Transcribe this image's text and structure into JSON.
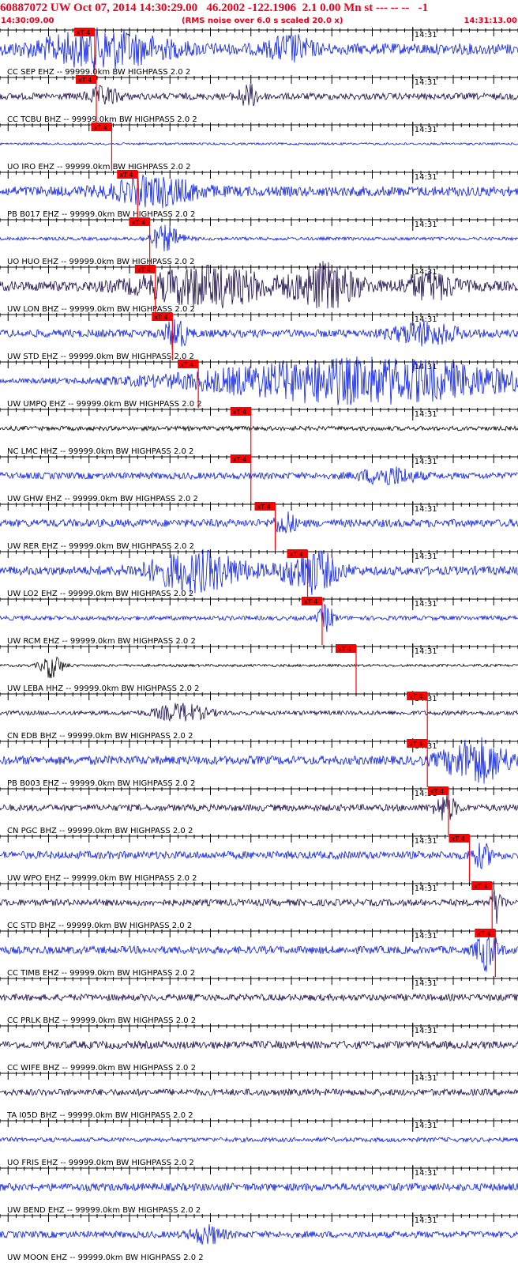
{
  "header": {
    "title": "60887072 UW Oct 07, 2014 14:30:29.00   46.2002 -122.1906  2.1 0.00 Mn st --- -- --   -1",
    "start_time": "14:30:09.00",
    "scale_note": "(RMS noise over 6.0 s scaled 20.0 x)",
    "end_time": "14:31:13.00"
  },
  "colors": {
    "header_red": "#e8001c",
    "pick_red": "#ff0000",
    "trace_blue": "#0a1ee6",
    "trace_dark": "#1a0a4a",
    "trace_black": "#000000",
    "grid": "#000000"
  },
  "chart_data": {
    "type": "seismogram",
    "time_start": "14:30:09.00",
    "time_end": "14:31:13.00",
    "minute_label": "14:31",
    "pick_label": "xT 4",
    "traces": [
      {
        "label": "CC SEP EHZ -- 99999.0km BW  HIGHPASS  2.0  2",
        "color": "blue",
        "pick": "14:30:20.7",
        "amp": 0.5,
        "bursts": [
          [
            0.2,
            0.12,
            0.8
          ],
          [
            0.56,
            0.04,
            0.55
          ]
        ]
      },
      {
        "label": "CC TCBU BHZ -- 99999.0km BW  HIGHPASS  2.0  2",
        "color": "dark",
        "pick": "14:30:20.9",
        "amp": 0.3,
        "bursts": [
          [
            0.2,
            0.03,
            0.4
          ],
          [
            0.48,
            0.02,
            0.5
          ]
        ]
      },
      {
        "label": "UO IRO EHZ -- 99999.0km BW  HIGHPASS  2.0  2",
        "color": "blue",
        "pick": "14:30:22.8",
        "amp": 0.1,
        "bursts": []
      },
      {
        "label": "PB B017 EHZ -- 99999.0km BW  HIGHPASS  2.0  2",
        "color": "blue",
        "pick": "14:30:26.0",
        "amp": 0.45,
        "bursts": [
          [
            0.3,
            0.08,
            0.6
          ]
        ]
      },
      {
        "label": "UO HUO EHZ -- 99999.0km BW  HIGHPASS  2.0  2",
        "color": "blue",
        "pick": "14:30:27.5",
        "amp": 0.15,
        "bursts": [
          [
            0.32,
            0.03,
            0.6
          ]
        ]
      },
      {
        "label": "UW LON BHZ -- 99999.0km BW  HIGHPASS  2.0  2",
        "color": "dark",
        "pick": "14:30:28.2",
        "amp": 0.45,
        "bursts": [
          [
            0.4,
            0.12,
            0.9
          ],
          [
            0.63,
            0.06,
            1.0
          ],
          [
            0.83,
            0.05,
            0.6
          ]
        ]
      },
      {
        "label": "UW STD EHZ -- 99999.0km BW  HIGHPASS  2.0  2",
        "color": "blue",
        "pick": "14:30:30.3",
        "amp": 0.35,
        "bursts": [
          [
            0.34,
            0.02,
            0.8
          ],
          [
            0.82,
            0.06,
            0.5
          ]
        ]
      },
      {
        "label": "UW UMPQ EHZ -- 99999.0km BW  HIGHPASS  2.0  2",
        "color": "blue",
        "pick": "14:30:33.5",
        "amp": 0.2,
        "bursts": [
          [
            0.7,
            0.32,
            1.1
          ]
        ]
      },
      {
        "label": "NC LMC HHZ -- 99999.0km BW  HIGHPASS  2.0  2",
        "color": "black",
        "pick": "14:30:40.0",
        "amp": 0.2,
        "bursts": []
      },
      {
        "label": "UW GHW EHZ -- 99999.0km BW  HIGHPASS  2.0  2",
        "color": "blue",
        "pick": "14:30:40.0",
        "amp": 0.3,
        "bursts": [
          [
            0.75,
            0.05,
            0.4
          ]
        ]
      },
      {
        "label": "UW RER EHZ -- 99999.0km BW  HIGHPASS  2.0  2",
        "color": "blue",
        "pick": "14:30:43.0",
        "amp": 0.35,
        "bursts": [
          [
            0.55,
            0.02,
            0.5
          ]
        ]
      },
      {
        "label": "UW LO2 EHZ -- 99999.0km BW  HIGHPASS  2.0  2",
        "color": "blue",
        "pick": "14:30:47.0",
        "amp": 0.4,
        "bursts": [
          [
            0.38,
            0.09,
            0.9
          ],
          [
            0.6,
            0.05,
            1.0
          ]
        ]
      },
      {
        "label": "UW RCM EHZ -- 99999.0km BW  HIGHPASS  2.0  2",
        "color": "blue",
        "pick": "14:30:48.8",
        "amp": 0.2,
        "bursts": [
          [
            0.63,
            0.015,
            0.6
          ]
        ]
      },
      {
        "label": "UW LEBA HHZ -- 99999.0km BW  HIGHPASS  2.0  2",
        "color": "black",
        "pick": "14:30:53.0",
        "amp": 0.12,
        "bursts": [
          [
            0.1,
            0.02,
            0.6
          ]
        ]
      },
      {
        "label": "CN EDB BHZ -- 99999.0km BW  HIGHPASS  2.0  2",
        "color": "dark",
        "pick": "14:31:01.8",
        "amp": 0.2,
        "bursts": [
          [
            0.35,
            0.05,
            0.4
          ]
        ]
      },
      {
        "label": "PB B003 EHZ -- 99999.0km BW  HIGHPASS  2.0  2",
        "color": "blue",
        "pick": "14:31:01.8",
        "amp": 0.4,
        "bursts": [
          [
            0.92,
            0.06,
            1.0
          ]
        ]
      },
      {
        "label": "CN PGC BHZ -- 99999.0km BW  HIGHPASS  2.0  2",
        "color": "dark",
        "pick": "14:31:04.4",
        "amp": 0.3,
        "bursts": [
          [
            0.86,
            0.02,
            0.6
          ]
        ]
      },
      {
        "label": "UW WPO EHZ -- 99999.0km BW  HIGHPASS  2.0  2",
        "color": "blue",
        "pick": "14:31:07.0",
        "amp": 0.35,
        "bursts": [
          [
            0.93,
            0.02,
            0.5
          ]
        ]
      },
      {
        "label": "CC STD BHZ -- 99999.0km BW  HIGHPASS  2.0  2",
        "color": "dark",
        "pick": "14:31:09.8",
        "amp": 0.3,
        "bursts": [
          [
            0.96,
            0.01,
            0.9
          ]
        ]
      },
      {
        "label": "CC TIMB EHZ -- 99999.0km BW  HIGHPASS  2.0  2",
        "color": "blue",
        "pick": "14:31:10.2",
        "amp": 0.35,
        "bursts": [
          [
            0.94,
            0.02,
            0.9
          ]
        ]
      },
      {
        "label": "CC PRLK BHZ -- 99999.0km BW  HIGHPASS  2.0  2",
        "color": "dark",
        "pick": null,
        "amp": 0.3,
        "bursts": []
      },
      {
        "label": "CC WIFE BHZ -- 99999.0km BW  HIGHPASS  2.0  2",
        "color": "dark",
        "pick": null,
        "amp": 0.35,
        "bursts": []
      },
      {
        "label": "TA I05D BHZ -- 99999.0km BW  HIGHPASS  2.0  2",
        "color": "dark",
        "pick": null,
        "amp": 0.3,
        "bursts": []
      },
      {
        "label": "UO FRIS EHZ -- 99999.0km BW  HIGHPASS  2.0  2",
        "color": "blue",
        "pick": null,
        "amp": 0.2,
        "bursts": []
      },
      {
        "label": "UW BEND EHZ -- 99999.0km BW  HIGHPASS  2.0  2",
        "color": "blue",
        "pick": null,
        "amp": 0.35,
        "bursts": []
      },
      {
        "label": "UW MOON EHZ -- 99999.0km BW  HIGHPASS  2.0  2",
        "color": "blue",
        "pick": null,
        "amp": 0.3,
        "bursts": [
          [
            0.4,
            0.03,
            0.4
          ]
        ]
      }
    ]
  }
}
